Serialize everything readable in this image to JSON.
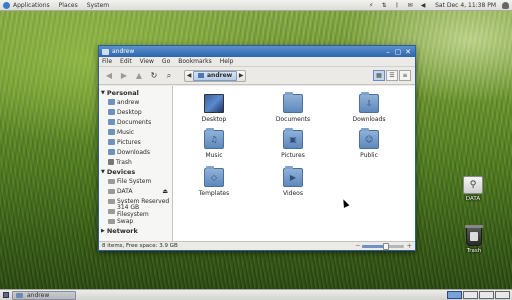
{
  "top_panel": {
    "menus": [
      "Applications",
      "Places",
      "System"
    ],
    "clock": "Sat Dec  4, 11:38 PM"
  },
  "bottom_panel": {
    "task": "andrew",
    "workspace_count": 4,
    "active_workspace": 1
  },
  "desktop_icons": [
    {
      "label": "DATA"
    },
    {
      "label": "Trash"
    }
  ],
  "window": {
    "title": "andrew",
    "menu": [
      "File",
      "Edit",
      "View",
      "Go",
      "Bookmarks",
      "Help"
    ],
    "path": "andrew",
    "sidebar": {
      "sections": [
        {
          "heading": "Personal",
          "items": [
            "andrew",
            "Desktop",
            "Documents",
            "Music",
            "Pictures",
            "Downloads",
            "Trash"
          ]
        },
        {
          "heading": "Devices",
          "items": [
            "File System",
            "DATA",
            "System Reserved",
            "314 GB Filesystem",
            "Swap"
          ]
        },
        {
          "heading": "Network",
          "items": []
        }
      ]
    },
    "files": [
      "Desktop",
      "Documents",
      "Downloads",
      "Music",
      "Pictures",
      "Public",
      "Templates",
      "Videos"
    ],
    "status": "8 items, Free space: 3.9 GB",
    "zoom_fraction": 0.55
  }
}
